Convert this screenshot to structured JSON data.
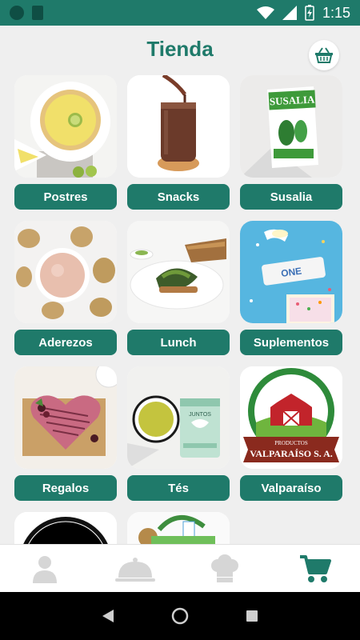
{
  "status_bar": {
    "time": "1:15"
  },
  "header": {
    "title": "Tienda"
  },
  "categories": [
    {
      "label": "Postres"
    },
    {
      "label": "Snacks"
    },
    {
      "label": "Susalia",
      "image_text": "SUSALIA"
    },
    {
      "label": "Aderezos"
    },
    {
      "label": "Lunch"
    },
    {
      "label": "Suplementos",
      "image_text": "ONE"
    },
    {
      "label": "Regalos"
    },
    {
      "label": "Tés",
      "image_text": "JUNTOS"
    },
    {
      "label": "Valparaíso",
      "image_text": [
        "PRODUCTOS",
        "VALPARAÍSO S. A."
      ]
    }
  ],
  "bottom_nav": [
    {
      "icon": "user-icon"
    },
    {
      "icon": "cloche-icon"
    },
    {
      "icon": "chef-hat-icon"
    },
    {
      "icon": "cart-icon",
      "active": true
    }
  ],
  "colors": {
    "brand": "#1f7a6a",
    "inactive_icon": "#d6d6d6",
    "background": "#efefef"
  }
}
